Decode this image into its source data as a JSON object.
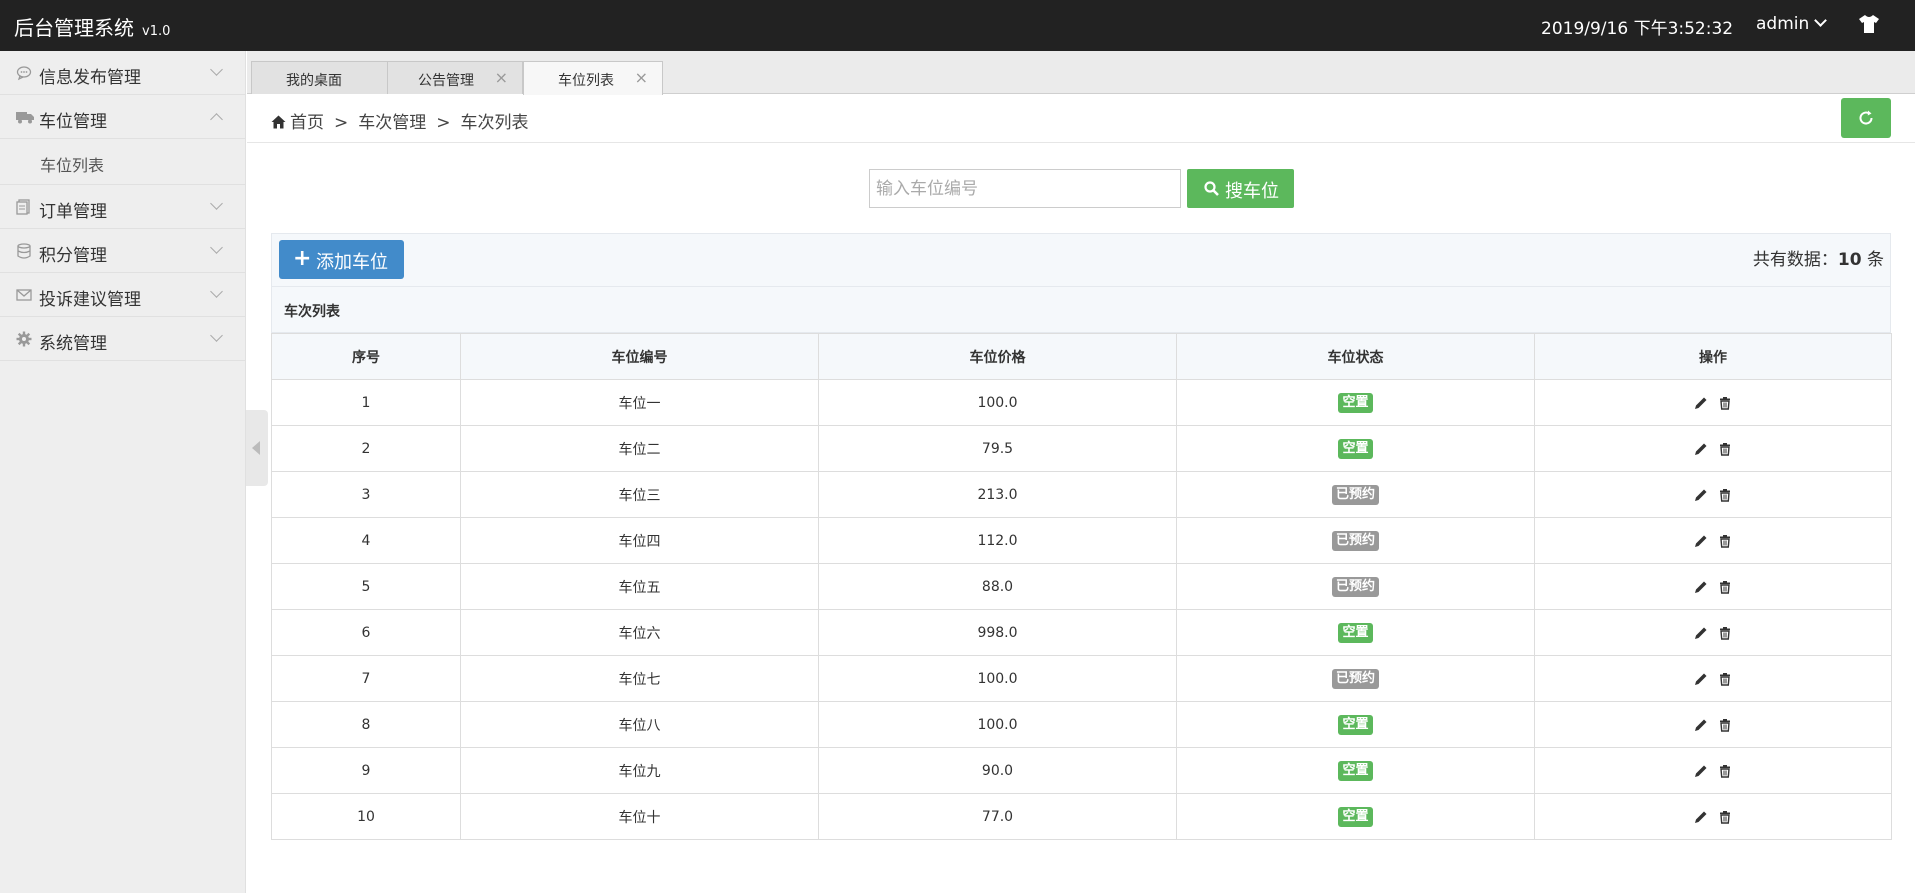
{
  "header": {
    "app_title": "后台管理系统",
    "version": "v1.0",
    "datetime": "2019/9/16 下午3:52:32",
    "user": "admin"
  },
  "sidebar": {
    "items": [
      {
        "label": "信息发布管理",
        "icon": "chat-icon",
        "expanded": false
      },
      {
        "label": "车位管理",
        "icon": "truck-icon",
        "expanded": true,
        "children": [
          {
            "label": "车位列表"
          }
        ]
      },
      {
        "label": "订单管理",
        "icon": "document-icon",
        "expanded": false
      },
      {
        "label": "积分管理",
        "icon": "database-icon",
        "expanded": false
      },
      {
        "label": "投诉建议管理",
        "icon": "envelope-icon",
        "expanded": false
      },
      {
        "label": "系统管理",
        "icon": "gear-icon",
        "expanded": false
      }
    ]
  },
  "tabs": [
    {
      "label": "我的桌面",
      "closable": false
    },
    {
      "label": "公告管理",
      "closable": true
    },
    {
      "label": "车位列表",
      "closable": true,
      "active": true
    }
  ],
  "breadcrumb": {
    "home": "首页",
    "sep": ">",
    "level1": "车次管理",
    "level2": "车次列表"
  },
  "search": {
    "placeholder": "输入车位编号",
    "button": "搜车位"
  },
  "toolbar": {
    "add_button": "添加车位",
    "total_prefix": "共有数据：",
    "total_count": "10",
    "total_suffix": "条"
  },
  "table": {
    "caption": "车次列表",
    "headers": [
      "序号",
      "车位编号",
      "车位价格",
      "车位状态",
      "操作"
    ],
    "rows": [
      {
        "no": "1",
        "code": "车位一",
        "price": "100.0",
        "status": "空置"
      },
      {
        "no": "2",
        "code": "车位二",
        "price": "79.5",
        "status": "空置"
      },
      {
        "no": "3",
        "code": "车位三",
        "price": "213.0",
        "status": "已预约"
      },
      {
        "no": "4",
        "code": "车位四",
        "price": "112.0",
        "status": "已预约"
      },
      {
        "no": "5",
        "code": "车位五",
        "price": "88.0",
        "status": "已预约"
      },
      {
        "no": "6",
        "code": "车位六",
        "price": "998.0",
        "status": "空置"
      },
      {
        "no": "7",
        "code": "车位七",
        "price": "100.0",
        "status": "已预约"
      },
      {
        "no": "8",
        "code": "车位八",
        "price": "100.0",
        "status": "空置"
      },
      {
        "no": "9",
        "code": "车位九",
        "price": "90.0",
        "status": "空置"
      },
      {
        "no": "10",
        "code": "车位十",
        "price": "77.0",
        "status": "空置"
      }
    ]
  },
  "colors": {
    "header_bg": "#222222",
    "success": "#5cb85c",
    "primary": "#428bca",
    "booked": "#999999"
  }
}
